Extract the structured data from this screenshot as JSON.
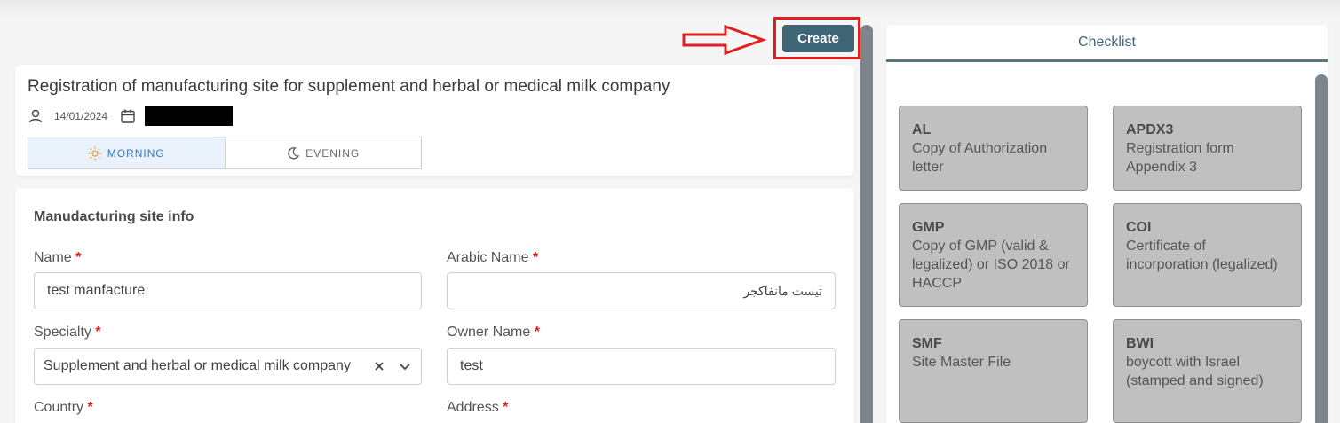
{
  "toolbar": {
    "create_label": "Create"
  },
  "header": {
    "title": "Registration of manufacturing site for supplement and herbal or medical milk company",
    "date": "14/01/2024",
    "shifts": [
      {
        "label": "MORNING",
        "icon": "sun-icon",
        "active": true
      },
      {
        "label": "EVENING",
        "icon": "moon-icon",
        "active": false
      }
    ]
  },
  "form": {
    "section_title": "Manudacturing site info",
    "fields": {
      "name": {
        "label": "Name",
        "value": "test manfacture"
      },
      "arabic_name": {
        "label": "Arabic Name",
        "value": "تيست مانفاكجر"
      },
      "specialty": {
        "label": "Specialty",
        "value": "Supplement and herbal or medical milk company"
      },
      "owner_name": {
        "label": "Owner Name",
        "value": "test"
      },
      "country": {
        "label": "Country"
      },
      "address": {
        "label": "Address"
      }
    },
    "required_mark": "*"
  },
  "checklist": {
    "title": "Checklist",
    "items": [
      {
        "code": "AL",
        "desc": "Copy of Authorization letter"
      },
      {
        "code": "APDX3",
        "desc": "Registration form Appendix 3"
      },
      {
        "code": "GMP",
        "desc": "Copy of GMP (valid & legalized) or ISO 2018 or HACCP"
      },
      {
        "code": "COI",
        "desc": "Certificate of incorporation (legalized)"
      },
      {
        "code": "SMF",
        "desc": "Site Master File"
      },
      {
        "code": "BWI",
        "desc": "boycott with Israel (stamped and signed)"
      }
    ]
  },
  "colors": {
    "accent": "#3f6677",
    "highlight": "#e0201e",
    "tile": "#c0c0c0"
  }
}
